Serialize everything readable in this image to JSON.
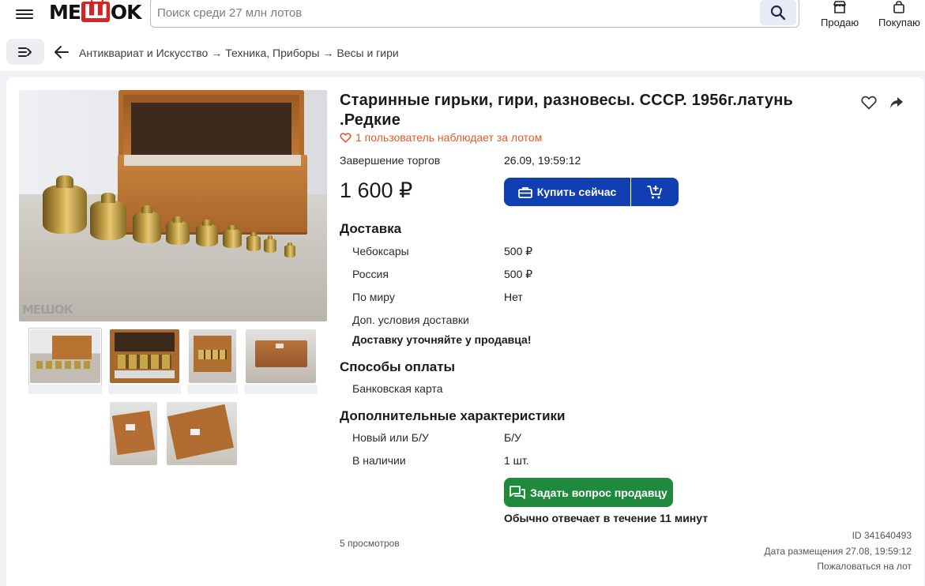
{
  "header": {
    "logo_text": "МЕШОК",
    "logo_parts": [
      "ME",
      "Ш",
      "OK"
    ],
    "search": {
      "placeholder": "Поиск среди 27 млн лотов"
    },
    "actions": [
      {
        "label": "Продаю",
        "icon": "shop-icon"
      },
      {
        "label": "Покупаю",
        "icon": "bag-icon"
      }
    ]
  },
  "breadcrumbs": [
    "Антиквариат и Искусство",
    "Техника, Приборы",
    "Весы и гири"
  ],
  "breadcrumb_separator": "→",
  "lot": {
    "title": "Старинные гирьки, гири, разновесы. СССР. 1956г.латунь .Редкие",
    "watchers": "1 пользователь наблюдает за лотом",
    "end_label": "Завершение торгов",
    "end_value": "26.09, 19:59:12",
    "price": "1 600 ₽",
    "buy_label": "Купить сейчас",
    "photo_watermark": "МЕШОК"
  },
  "delivery": {
    "title": "Доставка",
    "rows": [
      {
        "label": "Чебоксары",
        "value": "500 ₽"
      },
      {
        "label": "Россия",
        "value": "500 ₽"
      },
      {
        "label": "По миру",
        "value": "Нет"
      }
    ],
    "extra_label": "Доп. условия доставки",
    "extra_value": "Доставку уточняйте у продавца!"
  },
  "payment": {
    "title": "Способы оплаты",
    "methods": [
      "Банковская карта"
    ]
  },
  "characteristics": {
    "title": "Дополнительные характеристики",
    "rows": [
      {
        "label": "Новый или Б/У",
        "value": "Б/У"
      },
      {
        "label": "В наличии",
        "value": "1 шт."
      }
    ]
  },
  "seller": {
    "ask_label": "Задать вопрос продавцу",
    "reply_note": "Обычно отвечает в течение 11 минут"
  },
  "footer": {
    "views": "5 просмотров",
    "id": "ID 341640493",
    "posted": "Дата размещения 27.08, 19:59:12",
    "report": "Пожаловаться на лот"
  },
  "colors": {
    "brand_red": "#d32426",
    "primary_blue": "#0f3fb3",
    "ask_green": "#1f8a3b",
    "watch_orange": "#e55a2b"
  }
}
